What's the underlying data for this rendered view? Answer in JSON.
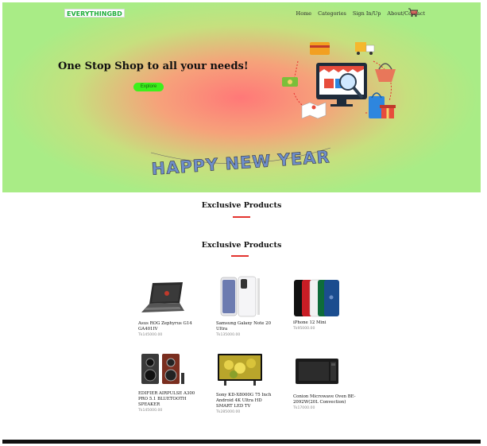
{
  "header": {
    "brand": "EVERYTHINGBD",
    "nav": [
      "Home",
      "Categories",
      "Sign In/Up",
      "About/Contact"
    ]
  },
  "hero": {
    "headline": "One Stop Shop to all your needs!",
    "cta_label": "Explore",
    "banner_text": "HAPPY NEW YEAR"
  },
  "sections": {
    "first_title": "Exclusive Products",
    "second_title": "Exclusive Products"
  },
  "products": [
    {
      "name": "Asus ROG Zephyrus G14 GA401IV",
      "price": "Tk145000.00"
    },
    {
      "name": "Samsung Galaxy Note 20 Ultra",
      "price": "Tk135000.00"
    },
    {
      "name": "iPhone 12 Mini",
      "price": "Tk95000.00"
    },
    {
      "name": "EDIFIER AIRPULSE A300 PRO 5.1 BLUETOOTH SPEAKER",
      "price": "Tk145000.00"
    },
    {
      "name": "Sony KD-X8000G 75 Inch Android 4K Ultra HD SMART LED TV",
      "price": "Tk285000.00"
    },
    {
      "name": "Conion Microwave Oven BE-2092W(20L Convection)",
      "price": "Tk17000.00"
    }
  ],
  "colors": {
    "hero_center": "#ff7878",
    "hero_edge": "#a9ec86",
    "accent_red": "#e3342f",
    "cta_green": "#3cf01c",
    "brand_green": "#1fae3a"
  },
  "icons": [
    "cart-icon",
    "store-illustration",
    "happy-new-year-banner"
  ]
}
